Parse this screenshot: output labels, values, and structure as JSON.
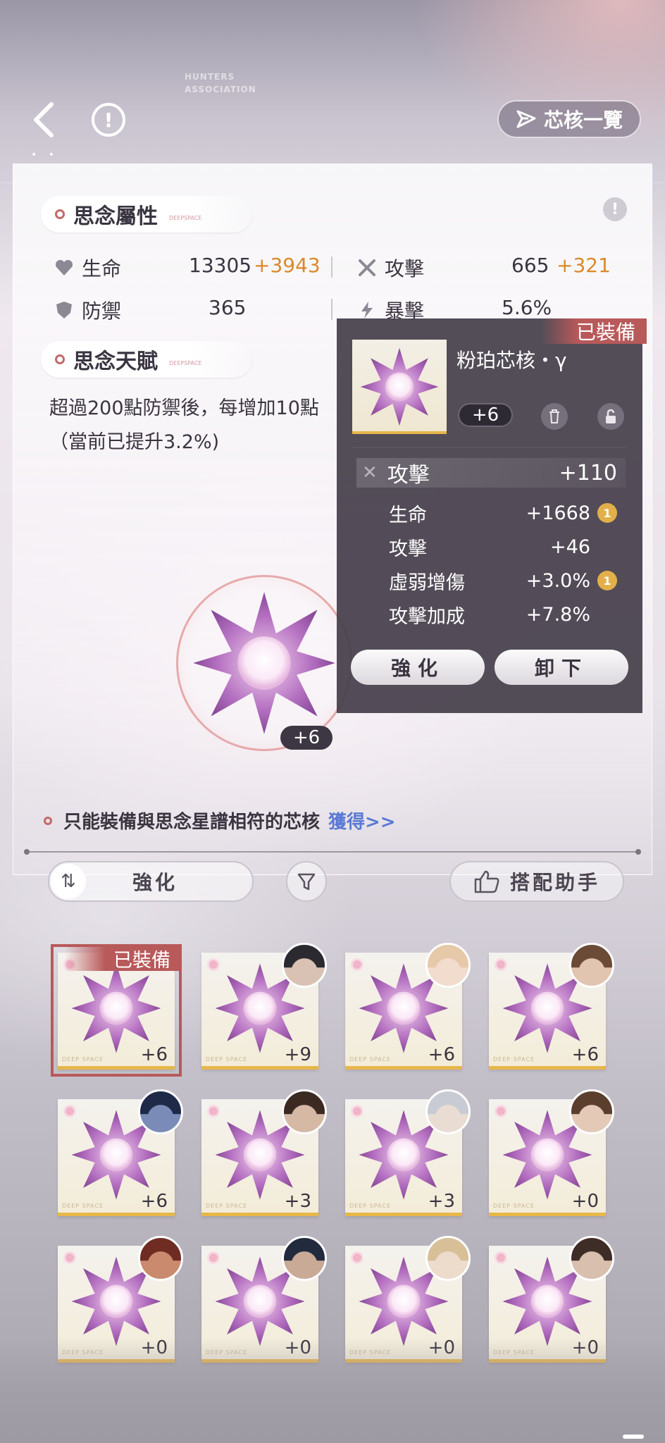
{
  "topbar": {
    "core_list_label": "芯核一覽",
    "logo_text": "HUNTERS ASSOCIATION"
  },
  "attributes": {
    "title": "思念屬性",
    "title_sub": "DEEPSPACE",
    "hp_label": "生命",
    "hp_value": "13305",
    "hp_bonus": "+3943",
    "atk_label": "攻擊",
    "atk_value": "665",
    "atk_bonus": "+321",
    "def_label": "防禦",
    "def_value": "365",
    "crit_label": "暴擊",
    "crit_value": "5.6%"
  },
  "talent": {
    "title": "思念天賦",
    "title_sub": "DEEPSPACE",
    "desc_line1": "超過200點防禦後，每增加10點",
    "desc_line2": "（當前已提升3.2%)"
  },
  "current_core": {
    "level": "+6"
  },
  "popup": {
    "equipped_tag": "已裝備",
    "name": "粉珀芯核・γ",
    "level": "+6",
    "main_stat_label": "攻擊",
    "main_stat_value": "+110",
    "sub_stats": [
      {
        "label": "生命",
        "value": "+1668",
        "upgrade": "1"
      },
      {
        "label": "攻擊",
        "value": "+46",
        "upgrade": ""
      },
      {
        "label": "虛弱增傷",
        "value": "+3.0%",
        "upgrade": "1"
      },
      {
        "label": "攻擊加成",
        "value": "+7.8%",
        "upgrade": ""
      }
    ],
    "enhance_label": "強化",
    "unequip_label": "卸下"
  },
  "hint": {
    "text": "只能裝備與思念星譜相符的芯核",
    "link": "獲得>>"
  },
  "controls": {
    "sort_label": "強化",
    "helper_label": "搭配助手"
  },
  "grid": {
    "deep_space": "DEEP SPACE",
    "equipped_tag": "已裝備",
    "items": [
      {
        "level": "+6",
        "avatar": "none",
        "equipped": true
      },
      {
        "level": "+9",
        "avatar": "avatar-dark-hair"
      },
      {
        "level": "+6",
        "avatar": "avatar-light-hair"
      },
      {
        "level": "+6",
        "avatar": "avatar-brown-hair"
      },
      {
        "level": "+6",
        "avatar": "avatar-blue-tone"
      },
      {
        "level": "+3",
        "avatar": "avatar-dark-brown"
      },
      {
        "level": "+3",
        "avatar": "avatar-silver-hair"
      },
      {
        "level": "+0",
        "avatar": "avatar-warm-brown"
      },
      {
        "level": "+0",
        "avatar": "avatar-red-tone"
      },
      {
        "level": "+0",
        "avatar": "avatar-dark-blue"
      },
      {
        "level": "+0",
        "avatar": "avatar-blonde"
      },
      {
        "level": "+0",
        "avatar": "avatar-dark-warm"
      }
    ]
  },
  "colors": {
    "accent_red": "#b8595a",
    "bonus_orange": "#d98a2a",
    "link_blue": "#5a79d4",
    "gold_bar": "#e6b74a"
  }
}
